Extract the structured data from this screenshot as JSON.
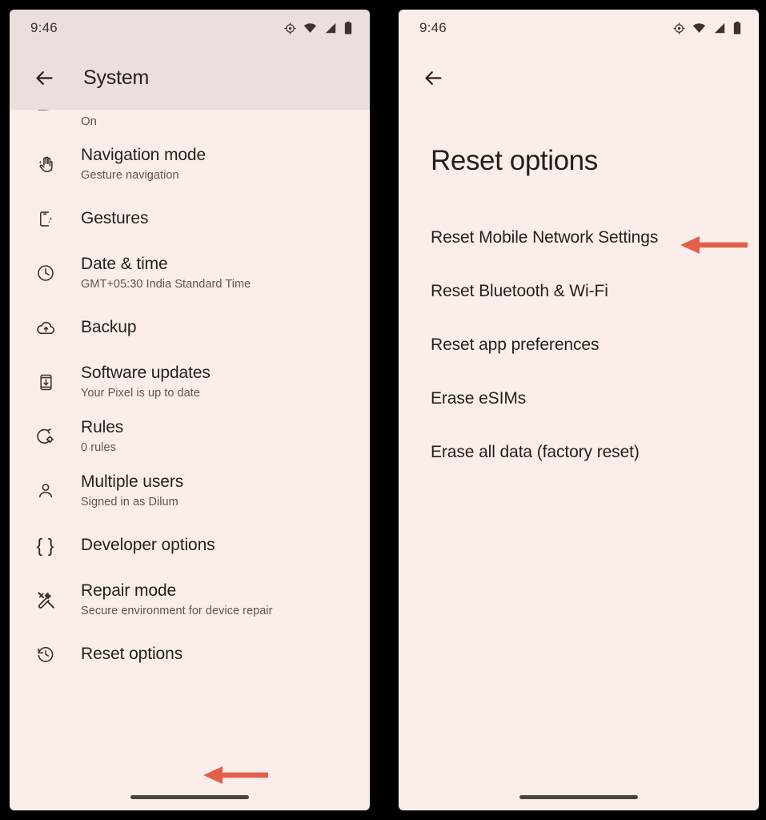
{
  "left_phone": {
    "status_bar": {
      "time": "9:46",
      "icons": [
        "location-icon",
        "wifi-icon",
        "cellular-signal-icon",
        "battery-icon"
      ]
    },
    "app_bar": {
      "back_label": "back-arrow",
      "title": "System"
    },
    "clipped_item": {
      "subtitle": "On"
    },
    "items": [
      {
        "title": "Navigation mode",
        "subtitle": "Gesture navigation",
        "icon": "hand-gesture-icon"
      },
      {
        "title": "Gestures",
        "subtitle": "",
        "icon": "phone-gesture-icon"
      },
      {
        "title": "Date & time",
        "subtitle": "GMT+05:30 India Standard Time",
        "icon": "clock-icon"
      },
      {
        "title": "Backup",
        "subtitle": "",
        "icon": "cloud-upload-icon"
      },
      {
        "title": "Software updates",
        "subtitle": "Your Pixel is up to date",
        "icon": "phone-download-icon"
      },
      {
        "title": "Rules",
        "subtitle": "0 rules",
        "icon": "rules-gear-icon"
      },
      {
        "title": "Multiple users",
        "subtitle": "Signed in as Dilum",
        "icon": "person-icon"
      },
      {
        "title": "Developer options",
        "subtitle": "",
        "icon": "braces-icon"
      },
      {
        "title": "Repair mode",
        "subtitle": "Secure environment for device repair",
        "icon": "hammer-wrench-icon"
      },
      {
        "title": "Reset options",
        "subtitle": "",
        "icon": "history-reset-icon"
      }
    ]
  },
  "right_phone": {
    "status_bar": {
      "time": "9:46",
      "icons": [
        "location-icon",
        "wifi-icon",
        "cellular-signal-icon",
        "battery-icon"
      ]
    },
    "app_bar": {
      "back_label": "back-arrow"
    },
    "page_title": "Reset options",
    "items": [
      {
        "label": "Reset Mobile Network Settings"
      },
      {
        "label": "Reset Bluetooth & Wi-Fi"
      },
      {
        "label": "Reset app preferences"
      },
      {
        "label": "Erase eSIMs"
      },
      {
        "label": "Erase all data (factory reset)"
      }
    ]
  },
  "annotations": {
    "arrow_color": "#E2604A",
    "left_arrow_target": "Reset options",
    "right_arrow_target": "Reset Mobile Network Settings"
  },
  "colors": {
    "background": "#000000",
    "surface": "#FBEEEA",
    "app_bar_tint": "#EADFDC",
    "text_primary": "#231F1E",
    "text_secondary": "#5E5553",
    "accent_arrow": "#E2604A",
    "gesture_bar": "#4A4341"
  }
}
